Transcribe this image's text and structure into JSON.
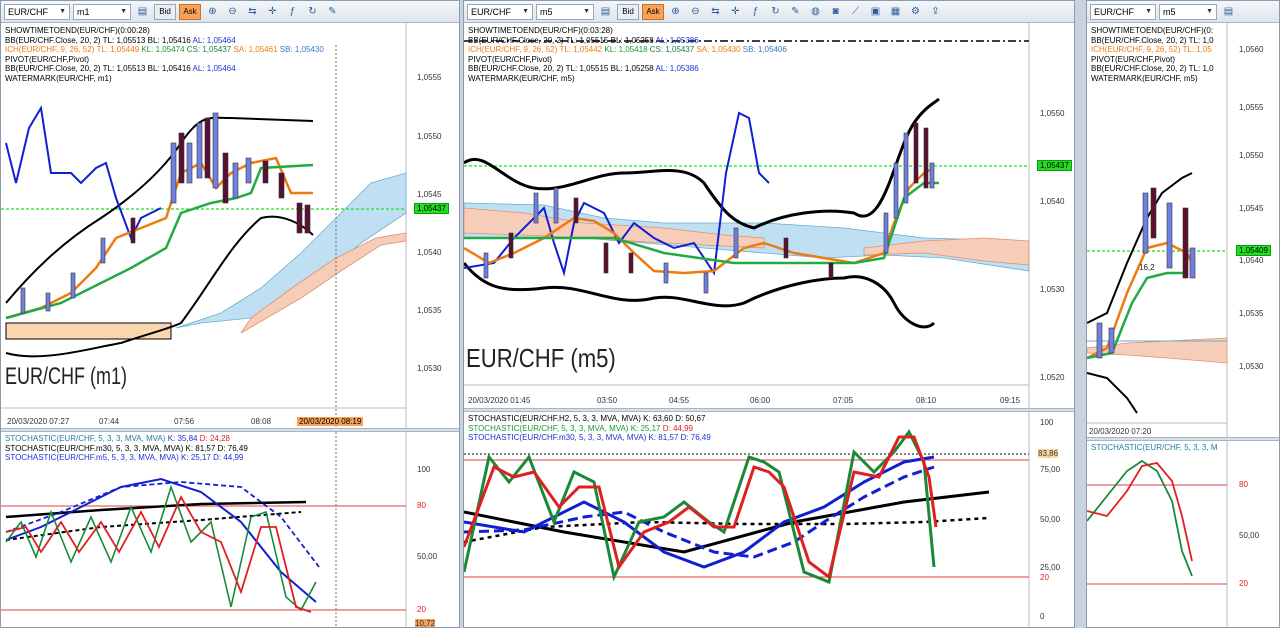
{
  "panel1": {
    "symbol": "EUR/CHF",
    "timeframe": "m1",
    "bid_label": "Bid",
    "ask_label": "Ask",
    "legend": {
      "l1": "SHOWTIMETOEND(EUR/CHF)(0:00:28)",
      "l2a": "BB(EUR/CHF.Close, 20, 2)",
      "l2b": "TL: 1,05513",
      "l2c": "BL: 1,05416",
      "l2d": "AL: 1,05464",
      "l3a": "ICH(EUR/CHF, 9, 26, 52)",
      "l3b": "TL: 1,05449",
      "l3c": "KL: 1,05474",
      "l3d": "CS: 1,05437",
      "l3e": "SA: 1,05461",
      "l3f": "SB: 1,05430",
      "l4": "PIVOT(EUR/CHF,Pivot)",
      "l5a": "BB(EUR/CHF.Close, 20, 2)",
      "l5b": "TL: 1,05513",
      "l5c": "BL: 1,05416",
      "l5d": "AL: 1,05464",
      "l6": "WATERMARK(EUR/CHF, m1)"
    },
    "watermark": "EUR/CHF (m1)",
    "price_labels": [
      "1,0555",
      "1,0550",
      "1,0545",
      "1,0540",
      "1,0535",
      "1,0530"
    ],
    "current_price": "1,05437",
    "time_labels": [
      "20/03/2020 07:27",
      "07:44",
      "07:56",
      "08:08"
    ],
    "time_tag": "20/03/2020 08:19",
    "stoch_legend": {
      "s1a": "STOCHASTIC(EUR/CHF, 5, 3, 3, MVA, MVA)",
      "s1b": "K: 35,84",
      "s1c": "D: 24,28",
      "s2a": "STOCHASTIC(EUR/CHF.m30, 5, 3, 3, MVA, MVA)",
      "s2b": "K: 81,57",
      "s2c": "D: 76,49",
      "s3a": "STOCHASTIC(EUR/CHF.m5, 5, 3, 3, MVA, MVA)",
      "s3b": "K: 25,17",
      "s3c": "D: 44,99"
    },
    "stoch_labels": [
      "100",
      "80",
      "50,00",
      "20",
      "10,72"
    ]
  },
  "panel2": {
    "symbol": "EUR/CHF",
    "timeframe": "m5",
    "bid_label": "Bid",
    "ask_label": "Ask",
    "legend": {
      "l1": "SHOWTIMETOEND(EUR/CHF)(0:03:28)",
      "l2a": "BB(EUR/CHF.Close, 20, 2)",
      "l2b": "TL: 1,05515",
      "l2c": "BL: 1,05258",
      "l2d": "AL: 1,05386",
      "l3a": "ICH(EUR/CHF, 9, 26, 52)",
      "l3b": "TL: 1,05442",
      "l3c": "KL: 1,05418",
      "l3d": "CS: 1,05437",
      "l3e": "SA: 1,05430",
      "l3f": "SB: 1,05406",
      "l4": "PIVOT(EUR/CHF,Pivot)",
      "l5a": "BB(EUR/CHF.Close, 20, 2)",
      "l5b": "TL: 1,05515",
      "l5c": "BL: 1,05258",
      "l5d": "AL: 1,05386",
      "l6": "WATERMARK(EUR/CHF, m5)"
    },
    "watermark": "EUR/CHF (m5)",
    "price_labels": [
      "1,0550",
      "1,0540",
      "1,0530",
      "1,0520"
    ],
    "current_price": "1,05437",
    "time_labels": [
      "20/03/2020 01:45",
      "03:50",
      "04:55",
      "06:00",
      "07:05",
      "08:10",
      "09:15"
    ],
    "stoch_legend": {
      "s1a": "STOCHASTIC(EUR/CHF.H2, 5, 3, 3, MVA, MVA)",
      "s1b": "K: 63,60",
      "s1c": "D: 50,67",
      "s2a": "STOCHASTIC(EUR/CHF, 5, 3, 3, MVA, MVA)",
      "s2b": "K: 25,17",
      "s2c": "D: 44,99",
      "s3a": "STOCHASTIC(EUR/CHF.m30, 5, 3, 3, MVA, MVA)",
      "s3b": "K: 81,57",
      "s3c": "D: 76,49"
    },
    "stoch_labels": [
      "100",
      "83,86",
      "75,00",
      "50,00",
      "25,00",
      "20",
      "0"
    ]
  },
  "panel3": {
    "symbol": "EUR/CHF",
    "timeframe": "m5",
    "legend": {
      "l1": "SHOWTIMETOEND(EUR/CHF)(0:",
      "l2a": "BB(EUR/CHF.Close, 20, 2)",
      "l2b": "TL: 1,0",
      "l3a": "ICH(EUR/CHF, 9, 26, 52)",
      "l3b": "TL: 1,05",
      "l4": "PIVOT(EUR/CHF,Pivot)",
      "l5a": "BB(EUR/CHF.Close, 20, 2)",
      "l5b": "TL: 1,0",
      "l6": "WATERMARK(EUR/CHF, m5)"
    },
    "price_labels": [
      "1,0560",
      "1,0555",
      "1,0550",
      "1,0545",
      "1,0540",
      "1,0535",
      "1,0530"
    ],
    "current_price": "1,05409",
    "annotation": "16,2",
    "time_labels": [
      "20/03/2020 07:20"
    ],
    "stoch_legend": {
      "s1": "STOCHASTIC(EUR/CHF, 5, 3, 3, M"
    },
    "stoch_labels": [
      "80",
      "50,00",
      "20"
    ]
  },
  "colors": {
    "bb": "#000000",
    "tenkan": "#f07a10",
    "kijun": "#22aa44",
    "chikou": "#1020d0",
    "cloud_bull": "#bfe0f2",
    "cloud_bear": "#f5cdb8",
    "pivot": "#22dd22",
    "candle_up": "#7080e0",
    "candle_down": "#5a1030",
    "stoch_k": "#1a8a3a",
    "stoch_d": "#e02020",
    "level": "#e04040"
  }
}
